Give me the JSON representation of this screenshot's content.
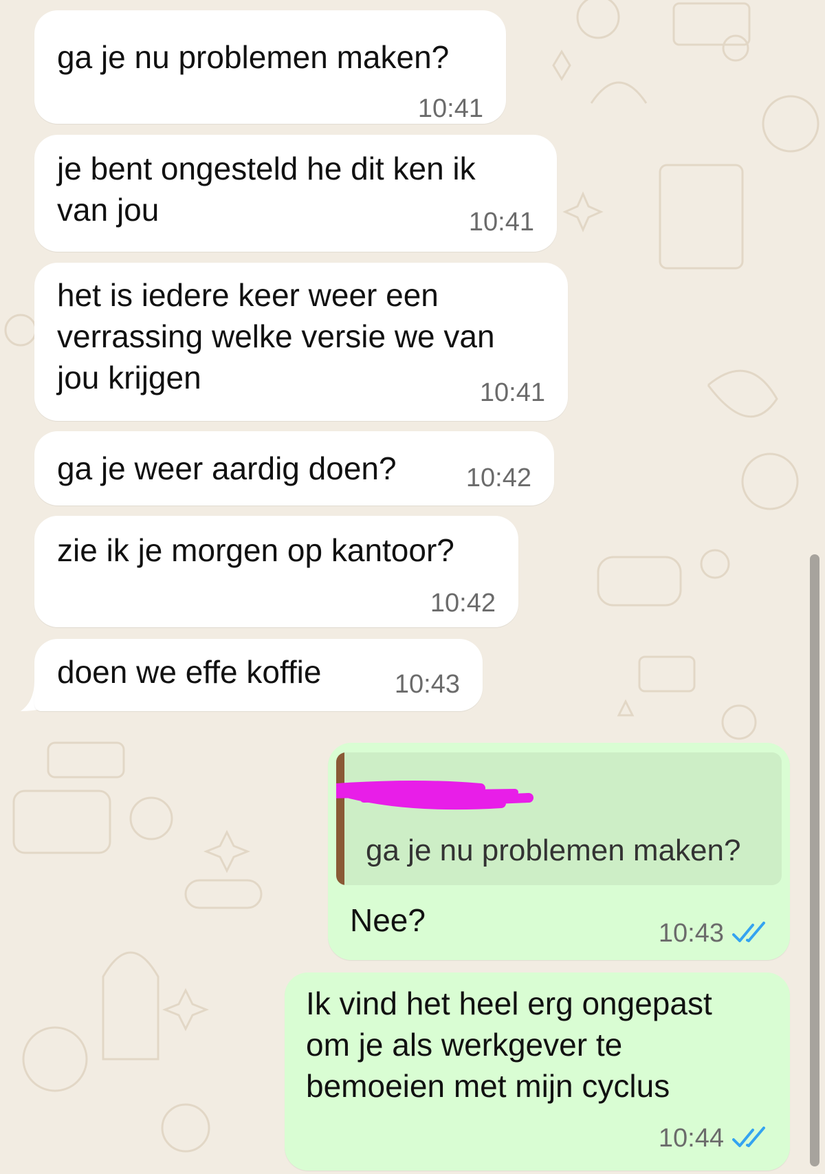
{
  "chat": {
    "incoming": [
      {
        "text": "ga je nu problemen maken?",
        "time": "10:41"
      },
      {
        "text": "je bent ongesteld he dit ken ik\nvan jou",
        "time": "10:41"
      },
      {
        "text": "het is iedere keer weer een\nverrassing welke versie we van\njou krijgen",
        "time": "10:41"
      },
      {
        "text": "ga je weer aardig doen?",
        "time": "10:42"
      },
      {
        "text": "zie ik je morgen op kantoor?",
        "time": "10:42"
      },
      {
        "text": "doen we effe koffie",
        "time": "10:43"
      }
    ],
    "outgoing": [
      {
        "quote": {
          "author_redacted": true,
          "text": "ga je nu problemen maken?"
        },
        "text": "Nee?",
        "time": "10:43",
        "status": "read"
      },
      {
        "text": "Ik vind het heel erg ongepast\nom je als werkgever te\nbemoeien met mijn cyclus",
        "time": "10:44",
        "status": "read"
      }
    ]
  },
  "icons": {
    "read_receipt": "double-check-icon",
    "quote_author_redaction": "scribble-redaction"
  },
  "colors": {
    "background": "#f2ece2",
    "incoming_bubble": "#ffffff",
    "outgoing_bubble": "#d9fdd3",
    "quote_background": "#cdeec6",
    "quote_bar": "#8a5a36",
    "read_receipt": "#34a3f0",
    "redaction": "#e81ee8",
    "scrollbar": "#a7a39d"
  }
}
